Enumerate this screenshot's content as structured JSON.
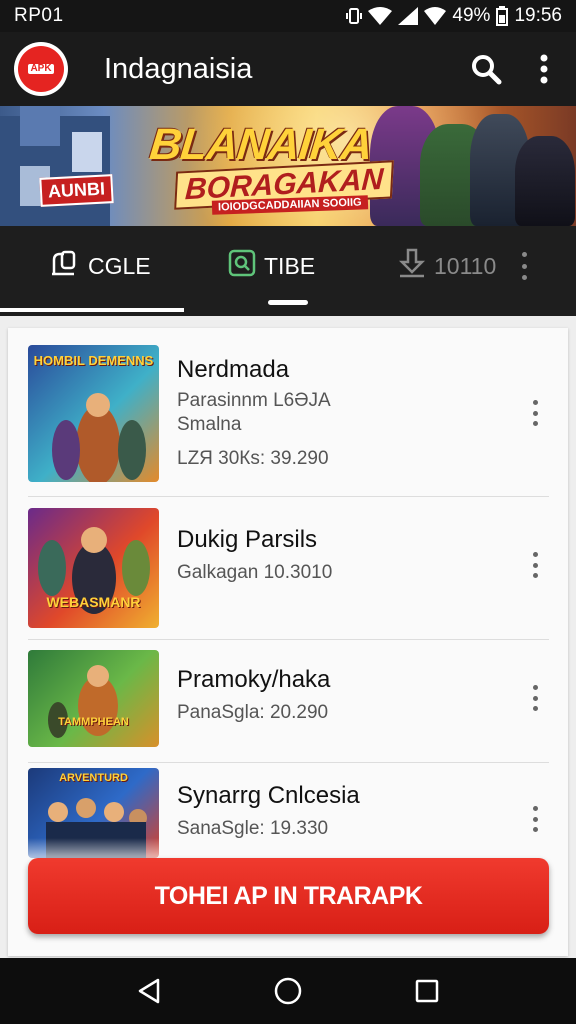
{
  "status_bar": {
    "carrier": "RP01",
    "battery_percent": "49%",
    "time": "19:56"
  },
  "app_bar": {
    "logo_text": "APK",
    "title": "Indagnaisia",
    "search_icon": "search-icon",
    "overflow_icon": "more-vert-icon"
  },
  "banner": {
    "title_line1": "BLANAIKA",
    "title_line2": "BORAGAKAN",
    "tagline": "IOIODGCADDAIIAN SOOIIG",
    "sign": "AUNBI"
  },
  "tabs": [
    {
      "label": "CGLE",
      "icon": "share-icon",
      "active": true
    },
    {
      "label": "TIBE",
      "icon": "search-box-icon",
      "active": false
    },
    {
      "label": "10110",
      "icon": "download-icon",
      "active": false
    }
  ],
  "items": [
    {
      "name": "Nerdmada",
      "lines": [
        "Parasinnm L6ƏJA",
        "Smalna"
      ],
      "meta": "LZЯ 30Кs: 39.290",
      "thumb_text": "HOMBIL DEMENNS",
      "colors": [
        "#2a4a9a",
        "#3fb0c8",
        "#e48a2a"
      ]
    },
    {
      "name": "Dukig Parsils",
      "lines": [],
      "meta": "Galkagan 10.3010",
      "thumb_text": "WEBASMANR",
      "colors": [
        "#6a2a8a",
        "#e0482a",
        "#f0b030"
      ]
    },
    {
      "name": "Pramoky/haka",
      "lines": [],
      "meta": "PanaSgla: 20.290",
      "thumb_text": "TAMMPHEAN",
      "colors": [
        "#2f7a3a",
        "#6ab848",
        "#d8902a"
      ]
    },
    {
      "name": "Synarrg Cnlcesia",
      "lines": [],
      "meta": "SanaSgle: 19.330",
      "thumb_text": "ARVENTURD",
      "colors": [
        "#1c3a7a",
        "#2e6ac8",
        "#d8402a"
      ]
    }
  ],
  "cta": {
    "label": "TOHEI AP IN TRARAPK"
  },
  "nav_bar": {
    "back_icon": "back-triangle-icon",
    "home_icon": "home-circle-icon",
    "recents_icon": "recents-square-icon"
  }
}
